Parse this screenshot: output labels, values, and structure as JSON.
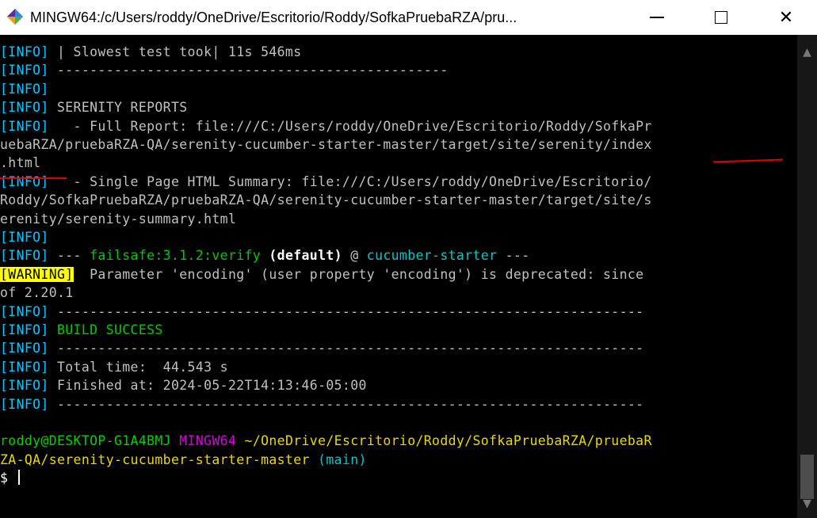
{
  "window": {
    "title": "MINGW64:/c/Users/roddy/OneDrive/Escritorio/Roddy/SofkaPruebaRZA/pru...",
    "icon": "mingw-terminal-icon",
    "min_label": "",
    "max_label": "",
    "close_label": "✕"
  },
  "terminal": {
    "lines": [
      {
        "tag": "[INFO]",
        "text": " | Slowest test took| 11s 546ms"
      },
      {
        "tag": "[INFO]",
        "text": " ------------------------------------------------"
      },
      {
        "tag": "[INFO]",
        "text": ""
      },
      {
        "tag": "[INFO]",
        "text": " SERENITY REPORTS"
      },
      {
        "tag": "[INFO]",
        "text": "   - Full Report: file:///C:/Users/roddy/OneDrive/Escritorio/Roddy/SofkaPr"
      },
      {
        "tag": "",
        "text": "uebaRZA/pruebaRZA-QA/serenity-cucumber-starter-master/target/site/serenity/index"
      },
      {
        "tag": "",
        "text": ".html"
      },
      {
        "tag": "[INFO]",
        "text": "   - Single Page HTML Summary: file:///C:/Users/roddy/OneDrive/Escritorio/"
      },
      {
        "tag": "",
        "text": "Roddy/SofkaPruebaRZA/pruebaRZA-QA/serenity-cucumber-starter-master/target/site/s"
      },
      {
        "tag": "",
        "text": "erenity/serenity-summary.html"
      },
      {
        "tag": "[INFO]",
        "text": ""
      }
    ],
    "failsafe_line": {
      "tag": "[INFO]",
      "prefix": " --- ",
      "plugin": "failsafe:3.1.2:verify",
      "goal": " (default)",
      "at": " @ ",
      "project": "cucumber-starter",
      "suffix": " ---"
    },
    "warning_line": {
      "tag": "[WARNING]",
      "text": "  Parameter 'encoding' (user property 'encoding') is deprecated: since",
      "continuation": "of 2.20.1"
    },
    "summary_lines": [
      {
        "tag": "[INFO]",
        "text": " ------------------------------------------------------------------------"
      },
      {
        "tag": "[INFO]",
        "text": " BUILD SUCCESS",
        "style": "green"
      },
      {
        "tag": "[INFO]",
        "text": " ------------------------------------------------------------------------"
      },
      {
        "tag": "[INFO]",
        "text": " Total time:  44.543 s"
      },
      {
        "tag": "[INFO]",
        "text": " Finished at: 2024-05-22T14:13:46-05:00"
      },
      {
        "tag": "[INFO]",
        "text": " ------------------------------------------------------------------------"
      }
    ],
    "prompt": {
      "user_host": "roddy@DESKTOP-G1A4BMJ",
      "shell": " MINGW64",
      "path": " ~/OneDrive/Escritorio/Roddy/SofkaPruebaRZA/pruebaR",
      "path_cont": "ZA-QA/serenity-cucumber-starter-master",
      "branch": " (main)",
      "symbol": "$ "
    }
  },
  "colors": {
    "background": "#000000",
    "info_tag": "#00c8ff",
    "warning_bg": "#ffff00",
    "success": "#00c800",
    "annotation": "#e00000"
  },
  "scrollbar": {
    "up_icon": "▲",
    "down_icon": "▼"
  }
}
